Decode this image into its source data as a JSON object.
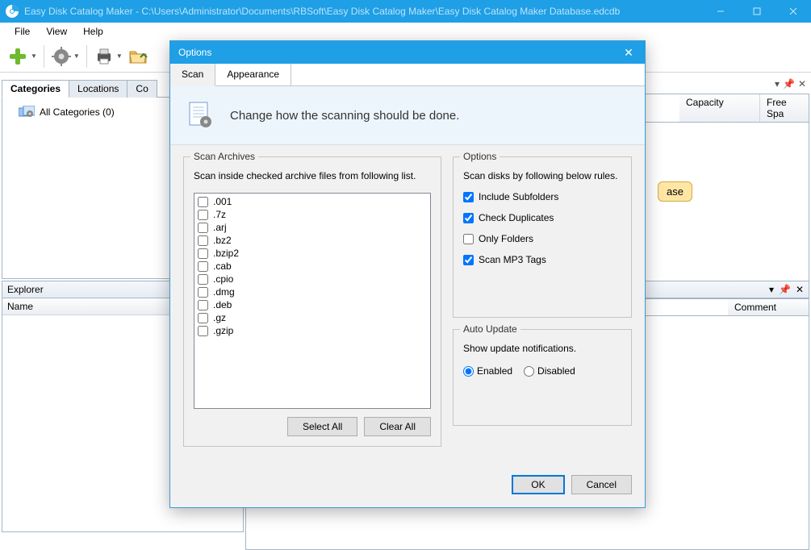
{
  "window": {
    "title": "Easy Disk Catalog Maker - C:\\Users\\Administrator\\Documents\\RBSoft\\Easy Disk Catalog Maker\\Easy Disk Catalog Maker Database.edcdb"
  },
  "menubar": {
    "file": "File",
    "view": "View",
    "help": "Help"
  },
  "left_tabs": {
    "categories": "Categories",
    "locations": "Locations",
    "contacts": "Co"
  },
  "tree": {
    "root": "All Categories (0)"
  },
  "explorer": {
    "title": "Explorer",
    "col_name": "Name"
  },
  "right_cols": {
    "capacity": "Capacity",
    "free_space": "Free Spa"
  },
  "right_lower_col": {
    "comment": "Comment"
  },
  "ase_badge": "ase",
  "dialog": {
    "title": "Options",
    "tabs": {
      "scan": "Scan",
      "appearance": "Appearance"
    },
    "banner": "Change how the scanning should be done.",
    "scan_archives": {
      "group_title": "Scan Archives",
      "desc": "Scan inside checked archive files from following list.",
      "items": [
        ".001",
        ".7z",
        ".arj",
        ".bz2",
        ".bzip2",
        ".cab",
        ".cpio",
        ".dmg",
        ".deb",
        ".gz",
        ".gzip"
      ],
      "select_all": "Select All",
      "clear_all": "Clear All"
    },
    "options_group": {
      "group_title": "Options",
      "desc": "Scan disks by following below rules.",
      "include_subfolders": {
        "label": "Include Subfolders",
        "checked": true
      },
      "check_duplicates": {
        "label": "Check Duplicates",
        "checked": true
      },
      "only_folders": {
        "label": "Only Folders",
        "checked": false
      },
      "scan_mp3": {
        "label": "Scan MP3 Tags",
        "checked": true
      }
    },
    "auto_update": {
      "group_title": "Auto Update",
      "desc": "Show update notifications.",
      "enabled": "Enabled",
      "disabled": "Disabled",
      "value": "enabled"
    },
    "ok": "OK",
    "cancel": "Cancel"
  }
}
